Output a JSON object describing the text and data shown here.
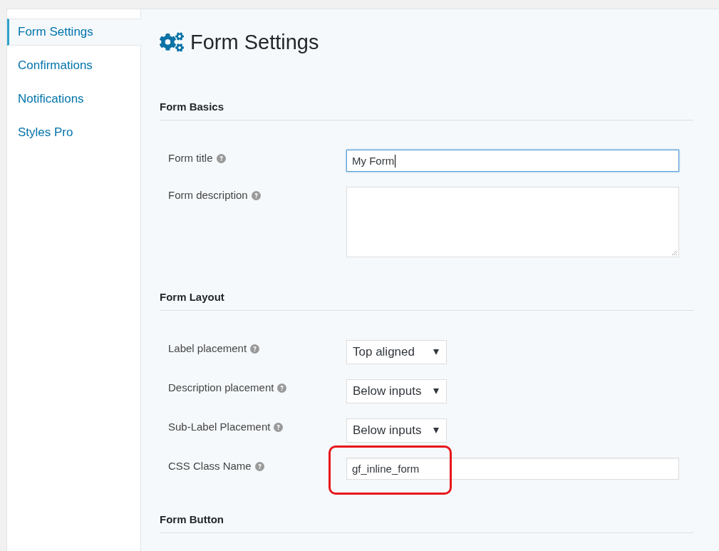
{
  "sidebar": {
    "items": [
      {
        "label": "Form Settings",
        "selected": true
      },
      {
        "label": "Confirmations",
        "selected": false
      },
      {
        "label": "Notifications",
        "selected": false
      },
      {
        "label": "Styles Pro",
        "selected": false
      }
    ]
  },
  "page": {
    "title": "Form Settings"
  },
  "sections": [
    {
      "heading": "Form Basics",
      "fields": [
        {
          "kind": "text",
          "label": "Form title",
          "value": "My Form",
          "focused": true,
          "highlighted": false
        },
        {
          "kind": "textarea",
          "label": "Form description",
          "focused": false,
          "highlighted": false
        }
      ]
    },
    {
      "heading": "Form Layout",
      "fields": [
        {
          "kind": "select",
          "label": "Label placement",
          "value": "Top aligned",
          "focused": false,
          "highlighted": false
        },
        {
          "kind": "select",
          "label": "Description placement",
          "value": "Below inputs",
          "focused": false,
          "highlighted": false
        },
        {
          "kind": "select",
          "label": "Sub-Label Placement",
          "value": "Below inputs",
          "focused": false,
          "highlighted": false
        },
        {
          "kind": "text",
          "label": "CSS Class Name",
          "value": "gf_inline_form",
          "focused": false,
          "highlighted": true
        }
      ]
    },
    {
      "heading": "Form Button"
    }
  ]
}
